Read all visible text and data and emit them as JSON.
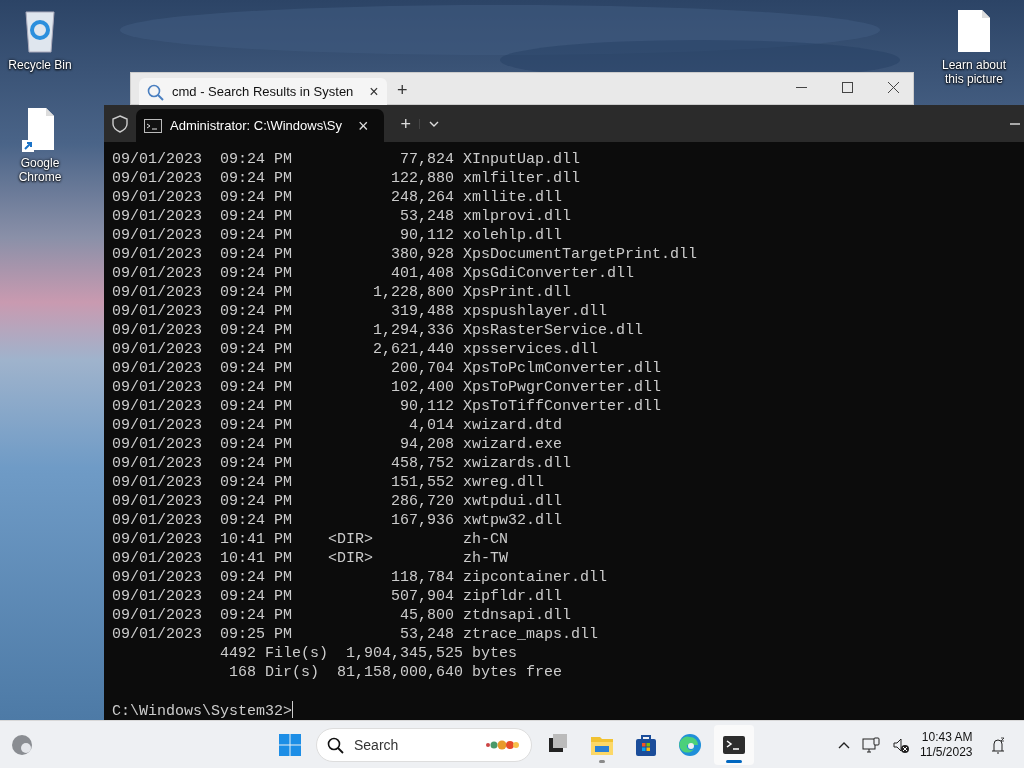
{
  "desktop_icons": [
    {
      "kind": "recycle-bin",
      "label": "Recycle Bin"
    },
    {
      "kind": "shortcut",
      "label": "Google Chrome"
    },
    {
      "kind": "document",
      "label": "Learn about this picture"
    }
  ],
  "explorer_window": {
    "tab": {
      "title": "cmd - Search Results in Systen",
      "close": "×"
    },
    "new_tab": "+"
  },
  "terminal": {
    "tab": {
      "title": "Administrator: C:\\Windows\\Sy",
      "close": "×"
    },
    "new_tab": "+",
    "lines": [
      {
        "kind": "file",
        "date": "09/01/2023",
        "time": "09:24 PM",
        "size": "77,824",
        "name": "XInputUap.dll"
      },
      {
        "kind": "file",
        "date": "09/01/2023",
        "time": "09:24 PM",
        "size": "122,880",
        "name": "xmlfilter.dll"
      },
      {
        "kind": "file",
        "date": "09/01/2023",
        "time": "09:24 PM",
        "size": "248,264",
        "name": "xmllite.dll"
      },
      {
        "kind": "file",
        "date": "09/01/2023",
        "time": "09:24 PM",
        "size": "53,248",
        "name": "xmlprovi.dll"
      },
      {
        "kind": "file",
        "date": "09/01/2023",
        "time": "09:24 PM",
        "size": "90,112",
        "name": "xolehlp.dll"
      },
      {
        "kind": "file",
        "date": "09/01/2023",
        "time": "09:24 PM",
        "size": "380,928",
        "name": "XpsDocumentTargetPrint.dll"
      },
      {
        "kind": "file",
        "date": "09/01/2023",
        "time": "09:24 PM",
        "size": "401,408",
        "name": "XpsGdiConverter.dll"
      },
      {
        "kind": "file",
        "date": "09/01/2023",
        "time": "09:24 PM",
        "size": "1,228,800",
        "name": "XpsPrint.dll"
      },
      {
        "kind": "file",
        "date": "09/01/2023",
        "time": "09:24 PM",
        "size": "319,488",
        "name": "xpspushlayer.dll"
      },
      {
        "kind": "file",
        "date": "09/01/2023",
        "time": "09:24 PM",
        "size": "1,294,336",
        "name": "XpsRasterService.dll"
      },
      {
        "kind": "file",
        "date": "09/01/2023",
        "time": "09:24 PM",
        "size": "2,621,440",
        "name": "xpsservices.dll"
      },
      {
        "kind": "file",
        "date": "09/01/2023",
        "time": "09:24 PM",
        "size": "200,704",
        "name": "XpsToPclmConverter.dll"
      },
      {
        "kind": "file",
        "date": "09/01/2023",
        "time": "09:24 PM",
        "size": "102,400",
        "name": "XpsToPwgrConverter.dll"
      },
      {
        "kind": "file",
        "date": "09/01/2023",
        "time": "09:24 PM",
        "size": "90,112",
        "name": "XpsToTiffConverter.dll"
      },
      {
        "kind": "file",
        "date": "09/01/2023",
        "time": "09:24 PM",
        "size": "4,014",
        "name": "xwizard.dtd"
      },
      {
        "kind": "file",
        "date": "09/01/2023",
        "time": "09:24 PM",
        "size": "94,208",
        "name": "xwizard.exe"
      },
      {
        "kind": "file",
        "date": "09/01/2023",
        "time": "09:24 PM",
        "size": "458,752",
        "name": "xwizards.dll"
      },
      {
        "kind": "file",
        "date": "09/01/2023",
        "time": "09:24 PM",
        "size": "151,552",
        "name": "xwreg.dll"
      },
      {
        "kind": "file",
        "date": "09/01/2023",
        "time": "09:24 PM",
        "size": "286,720",
        "name": "xwtpdui.dll"
      },
      {
        "kind": "file",
        "date": "09/01/2023",
        "time": "09:24 PM",
        "size": "167,936",
        "name": "xwtpw32.dll"
      },
      {
        "kind": "dir",
        "date": "09/01/2023",
        "time": "10:41 PM",
        "size": "<DIR>",
        "name": "zh-CN"
      },
      {
        "kind": "dir",
        "date": "09/01/2023",
        "time": "10:41 PM",
        "size": "<DIR>",
        "name": "zh-TW"
      },
      {
        "kind": "file",
        "date": "09/01/2023",
        "time": "09:24 PM",
        "size": "118,784",
        "name": "zipcontainer.dll"
      },
      {
        "kind": "file",
        "date": "09/01/2023",
        "time": "09:24 PM",
        "size": "507,904",
        "name": "zipfldr.dll"
      },
      {
        "kind": "file",
        "date": "09/01/2023",
        "time": "09:24 PM",
        "size": "45,800",
        "name": "ztdnsapi.dll"
      },
      {
        "kind": "file",
        "date": "09/01/2023",
        "time": "09:25 PM",
        "size": "53,248",
        "name": "ztrace_maps.dll"
      },
      {
        "kind": "summary",
        "count": "4492",
        "text": "File(s)  1,904,345,525 bytes"
      },
      {
        "kind": "summary",
        "count": "168",
        "text": "Dir(s)  81,158,000,640 bytes free"
      },
      {
        "kind": "blank"
      },
      {
        "kind": "prompt",
        "text": "C:\\Windows\\System32>"
      }
    ]
  },
  "taskbar": {
    "search": {
      "placeholder": "Search"
    },
    "apps": [
      {
        "kind": "task-view",
        "selected": false,
        "running": false
      },
      {
        "kind": "file-explorer",
        "selected": false,
        "running": true
      },
      {
        "kind": "store",
        "selected": false,
        "running": false
      },
      {
        "kind": "edge",
        "selected": false,
        "running": false
      },
      {
        "kind": "terminal",
        "selected": true,
        "running": true
      }
    ],
    "clock": {
      "time": "10:43 AM",
      "date": "11/5/2023"
    }
  }
}
